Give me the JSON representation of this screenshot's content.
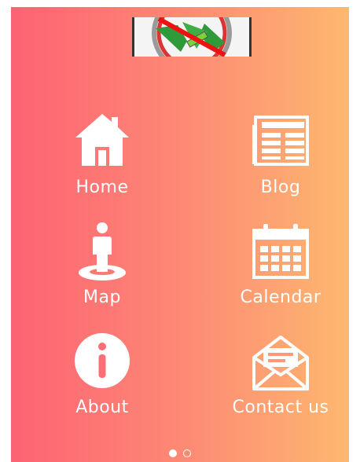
{
  "logo": {
    "icon": "no-cannabis-logo"
  },
  "menu": [
    {
      "label": "Home",
      "icon": "home-icon"
    },
    {
      "label": "Blog",
      "icon": "newspaper-icon"
    },
    {
      "label": "Map",
      "icon": "person-location-icon"
    },
    {
      "label": "Calendar",
      "icon": "calendar-icon"
    },
    {
      "label": "About",
      "icon": "info-icon"
    },
    {
      "label": "Contact us",
      "icon": "envelope-icon"
    }
  ],
  "pager": {
    "pages": 2,
    "current": 1
  },
  "colors": {
    "gradient_start": "#fd6273",
    "gradient_end": "#fdb870",
    "icon": "#ffffff"
  }
}
